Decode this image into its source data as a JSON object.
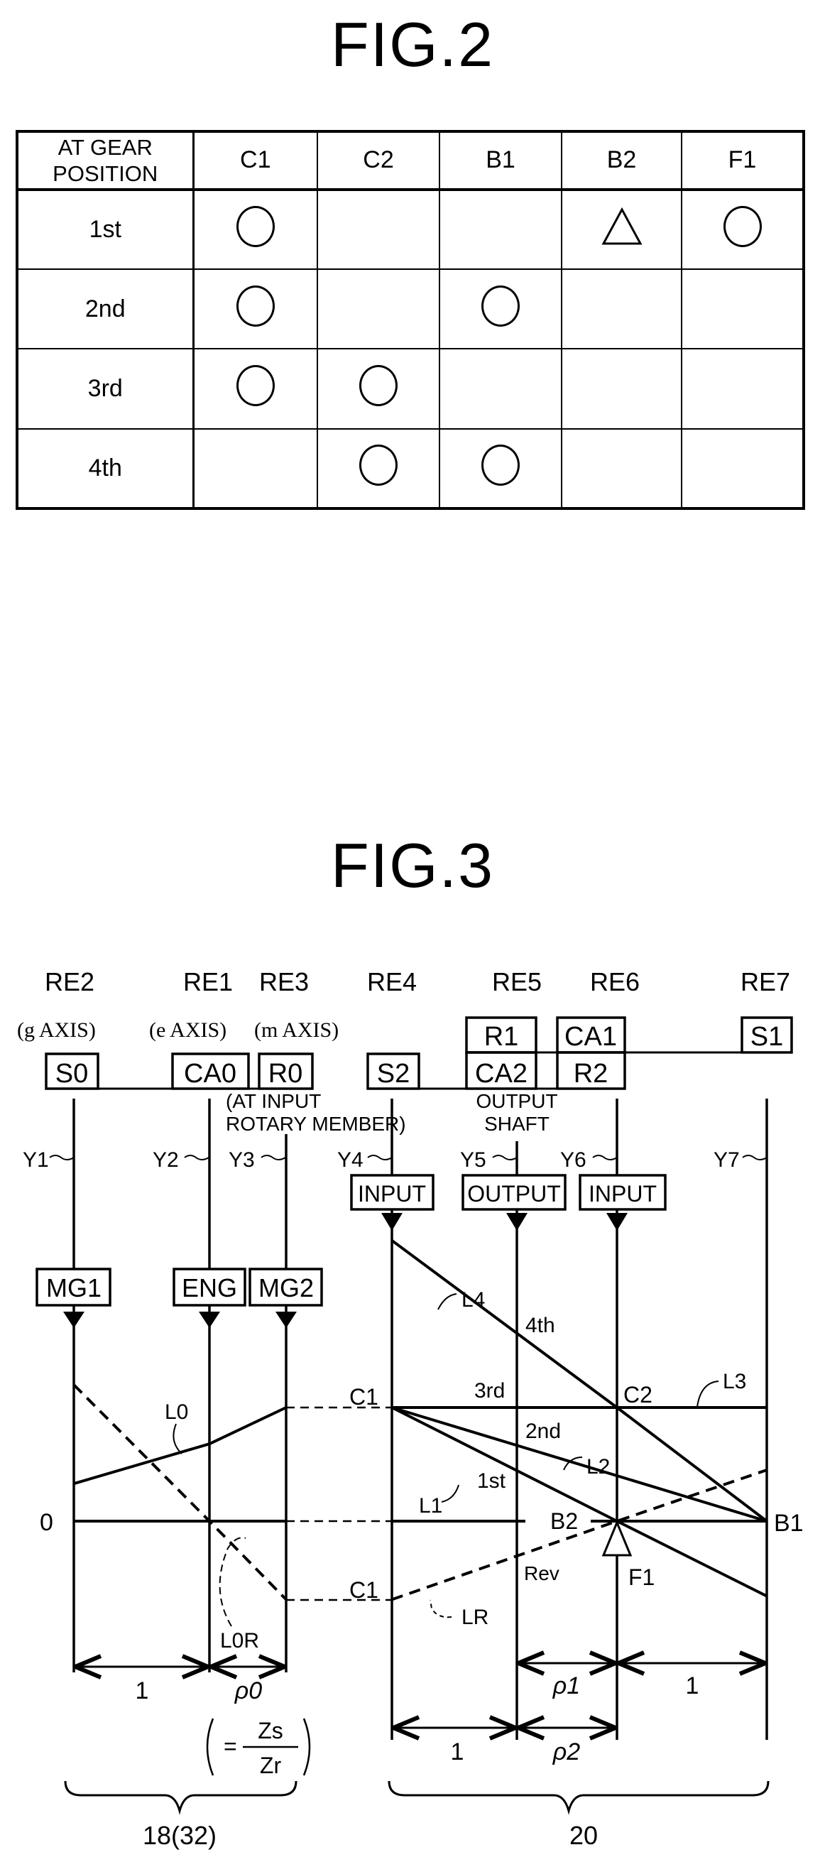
{
  "fig2": {
    "title": "FIG.2",
    "table": {
      "corner_header_lines": [
        "AT GEAR",
        "POSITION"
      ],
      "columns": [
        "C1",
        "C2",
        "B1",
        "B2",
        "F1"
      ],
      "rows": [
        {
          "label": "1st",
          "cells": [
            "circle",
            "",
            "",
            "triangle",
            "circle"
          ]
        },
        {
          "label": "2nd",
          "cells": [
            "circle",
            "",
            "circle",
            "",
            ""
          ]
        },
        {
          "label": "3rd",
          "cells": [
            "circle",
            "circle",
            "",
            "",
            ""
          ]
        },
        {
          "label": "4th",
          "cells": [
            "",
            "circle",
            "circle",
            "",
            ""
          ]
        }
      ]
    }
  },
  "fig3": {
    "title": "FIG.3",
    "rotary_elements": [
      {
        "id": "RE2",
        "axis_note": "(g AXIS)",
        "members": [
          "S0"
        ],
        "y_label": "Y1",
        "source_box": "MG1"
      },
      {
        "id": "RE1",
        "axis_note": "(e AXIS)",
        "members": [
          "CA0"
        ],
        "y_label": "Y2",
        "source_box": "ENG"
      },
      {
        "id": "RE3",
        "axis_note": "(m AXIS)",
        "members": [
          "R0"
        ],
        "y_label": "Y3",
        "source_box": "MG2"
      },
      {
        "id": "RE4",
        "axis_note": "",
        "members": [
          "S2"
        ],
        "y_label": "Y4",
        "source_box": "INPUT"
      },
      {
        "id": "RE5",
        "axis_note": "",
        "members": [
          "R1",
          "CA2"
        ],
        "y_label": "Y5",
        "source_box": "OUTPUT"
      },
      {
        "id": "RE6",
        "axis_note": "",
        "members": [
          "CA1",
          "R2"
        ],
        "y_label": "Y6",
        "source_box": "INPUT"
      },
      {
        "id": "RE7",
        "axis_note": "",
        "members": [
          "S1"
        ],
        "y_label": "Y7",
        "source_box": ""
      }
    ],
    "notes": {
      "at_input_line1": "(AT INPUT",
      "at_input_line2": "ROTARY MEMBER)",
      "output_line1": "OUTPUT",
      "output_line2": "SHAFT"
    },
    "zero_label": "0",
    "line_labels": {
      "L0": "L0",
      "L0R": "L0R",
      "L1": "L1",
      "L2": "L2",
      "L3": "L3",
      "L4": "L4",
      "LR": "LR"
    },
    "point_labels": {
      "C1_upper_left": "C1",
      "C1_lower_left": "C1",
      "C1_right": "C1",
      "C2": "C2",
      "B1": "B1",
      "B2": "B2",
      "F1": "F1"
    },
    "gear_labels": {
      "first": "1st",
      "second": "2nd",
      "third": "3rd",
      "fourth": "4th",
      "reverse": "Rev"
    },
    "dimensions": {
      "re2_re1": "1",
      "re1_re3": "ρ0",
      "formula_lhs": "=",
      "formula_num": "Zs",
      "formula_den": "Zr",
      "re5_re6_upper": "ρ1",
      "re6_re7": "1",
      "re4_re5": "1",
      "re5_re6_lower": "ρ2",
      "left_group_ref": "18(32)",
      "right_group_ref": "20"
    }
  },
  "chart_data": {
    "type": "line",
    "title": "FIG.3",
    "xlabel": "",
    "ylabel": "",
    "note": "Collinear (nomograph) diagram; x in relative gear-ratio spacing units, y in relative rotational speed (0 = zero line, 1 = input/C1 level)",
    "x_axes": {
      "differential": {
        "RE2": 0,
        "RE1": 1,
        "RE3": 1.55
      },
      "transmission": {
        "RE4": 0,
        "RE5": 1,
        "RE6": 1.8,
        "RE7": 3.0
      }
    },
    "series": [
      {
        "name": "L0",
        "style": "solid",
        "points": [
          [
            "RE2",
            0.33
          ],
          [
            "RE1",
            0.68
          ],
          [
            "RE3",
            1.0
          ]
        ]
      },
      {
        "name": "L0R",
        "style": "dashed",
        "points": [
          [
            "RE2",
            1.2
          ],
          [
            "RE1",
            0.0
          ],
          [
            "RE3",
            -0.69
          ]
        ]
      },
      {
        "name": "L1 (1st)",
        "style": "solid",
        "points": [
          [
            "RE4",
            1.0
          ],
          [
            "RE6",
            0.0
          ],
          [
            "RE7",
            -0.66
          ]
        ]
      },
      {
        "name": "L2 (2nd)",
        "style": "solid",
        "points": [
          [
            "RE4",
            1.0
          ],
          [
            "RE7",
            0.0
          ]
        ]
      },
      {
        "name": "L3 (3rd)",
        "style": "solid",
        "points": [
          [
            "RE4",
            1.0
          ],
          [
            "RE7",
            1.0
          ]
        ]
      },
      {
        "name": "L4 (4th)",
        "style": "solid",
        "points": [
          [
            "RE4",
            2.47
          ],
          [
            "RE6",
            1.0
          ],
          [
            "RE7",
            0.0
          ]
        ]
      },
      {
        "name": "LR (Rev)",
        "style": "dashed",
        "points": [
          [
            "RE4",
            -0.69
          ],
          [
            "RE6",
            0.0
          ],
          [
            "RE7",
            0.45
          ]
        ]
      }
    ],
    "ylim": [
      -0.8,
      2.6
    ]
  }
}
